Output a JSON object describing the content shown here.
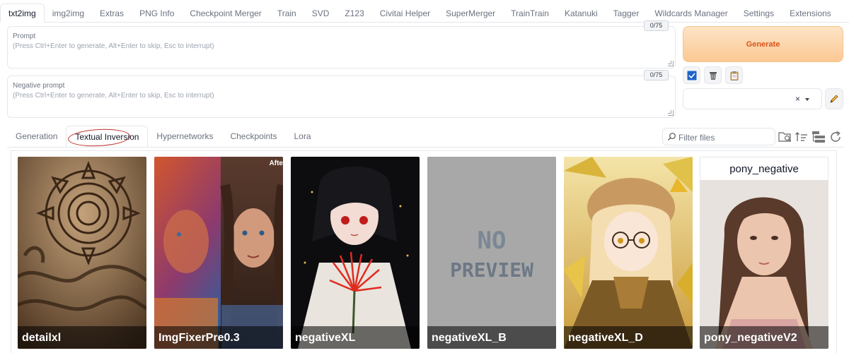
{
  "main_tabs": [
    "txt2img",
    "img2img",
    "Extras",
    "PNG Info",
    "Checkpoint Merger",
    "Train",
    "SVD",
    "Z123",
    "Civitai Helper",
    "SuperMerger",
    "TrainTrain",
    "Katanuki",
    "Tagger",
    "Wildcards Manager",
    "Settings",
    "Extensions"
  ],
  "prompt": {
    "label": "Prompt",
    "placeholder": "(Press Ctrl+Enter to generate, Alt+Enter to skip, Esc to interrupt)",
    "token_count": "0/75"
  },
  "negative_prompt": {
    "label": "Negative prompt",
    "placeholder": "(Press Ctrl+Enter to generate, Alt+Enter to skip, Esc to interrupt)",
    "token_count": "0/75"
  },
  "generate_label": "Generate",
  "styles": {
    "clear_glyph": "×"
  },
  "network_tabs": [
    "Generation",
    "Textual Inversion",
    "Hypernetworks",
    "Checkpoints",
    "Lora"
  ],
  "active_network_tab": "Textual Inversion",
  "filter": {
    "placeholder": "Filter files"
  },
  "cards": [
    {
      "name": "detailxl"
    },
    {
      "name": "ImgFixerPre0.3",
      "corner_text": "Afte"
    },
    {
      "name": "negativeXL"
    },
    {
      "name": "negativeXL_B",
      "preview_text_1": "NO",
      "preview_text_2": "PREVIEW"
    },
    {
      "name": "negativeXL_D"
    },
    {
      "name": "pony_negativeV2",
      "top_title": "pony_negative"
    }
  ],
  "colors": {
    "accent": "#d9541b",
    "generate_bg": "#fbc893",
    "circle_mark": "#c0322a",
    "checkbox": "#1e64c8"
  },
  "icons": [
    "checkbox-icon",
    "trash-icon",
    "clipboard-icon",
    "pencil-icon",
    "search-icon",
    "search-folder-icon",
    "sort-icon",
    "tree-view-icon",
    "refresh-icon"
  ]
}
